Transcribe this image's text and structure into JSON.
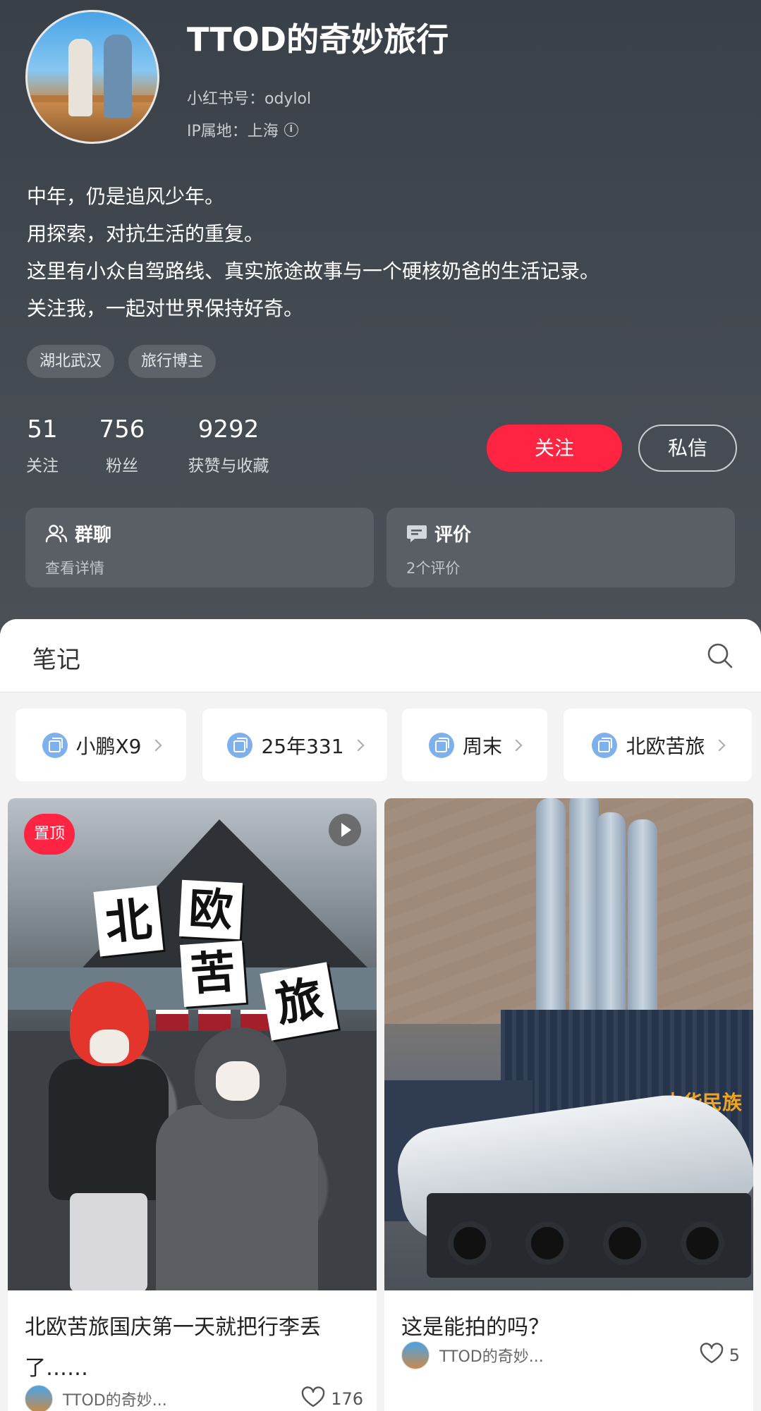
{
  "profile": {
    "name": "TTOD的奇妙旅行",
    "red_id": "小红书号：odylol",
    "ip": "IP属地：上海",
    "bio": [
      "中年，仍是追风少年。",
      "用探索，对抗生活的重复。",
      "这里有小众自驾路线、真实旅途故事与一个硬核奶爸的生活记录。",
      "关注我，一起对世界保持好奇。"
    ],
    "tags": [
      "湖北武汉",
      "旅行博主"
    ],
    "stats": [
      {
        "num": "51",
        "label": "关注"
      },
      {
        "num": "756",
        "label": "粉丝"
      },
      {
        "num": "9292",
        "label": "获赞与收藏"
      }
    ],
    "follow_label": "关注",
    "message_label": "私信",
    "cards": [
      {
        "title": "群聊",
        "sub": "查看详情",
        "icon": "group-icon"
      },
      {
        "title": "评价",
        "sub": "2个评价",
        "icon": "comment-icon"
      }
    ]
  },
  "notes_section": {
    "title": "笔记",
    "collections": [
      "小鹏X9",
      "25年331",
      "周末",
      "北欧苦旅"
    ],
    "notes": [
      {
        "title": "北欧苦旅国庆第一天就把行李丢了……",
        "pinned_label": "置顶",
        "cover_text": [
          "北",
          "欧",
          "苦",
          "旅"
        ],
        "has_video": true,
        "author": "TTOD的奇妙...",
        "likes": "176"
      },
      {
        "title": "这是能拍的吗？",
        "cover_text": [
          "中华民族"
        ],
        "author": "TTOD的奇妙...",
        "likes": "5"
      }
    ]
  },
  "colors": {
    "accent": "#ff2442",
    "header_bg": "#3f454c",
    "collection_icon": "#7fb0ee"
  }
}
